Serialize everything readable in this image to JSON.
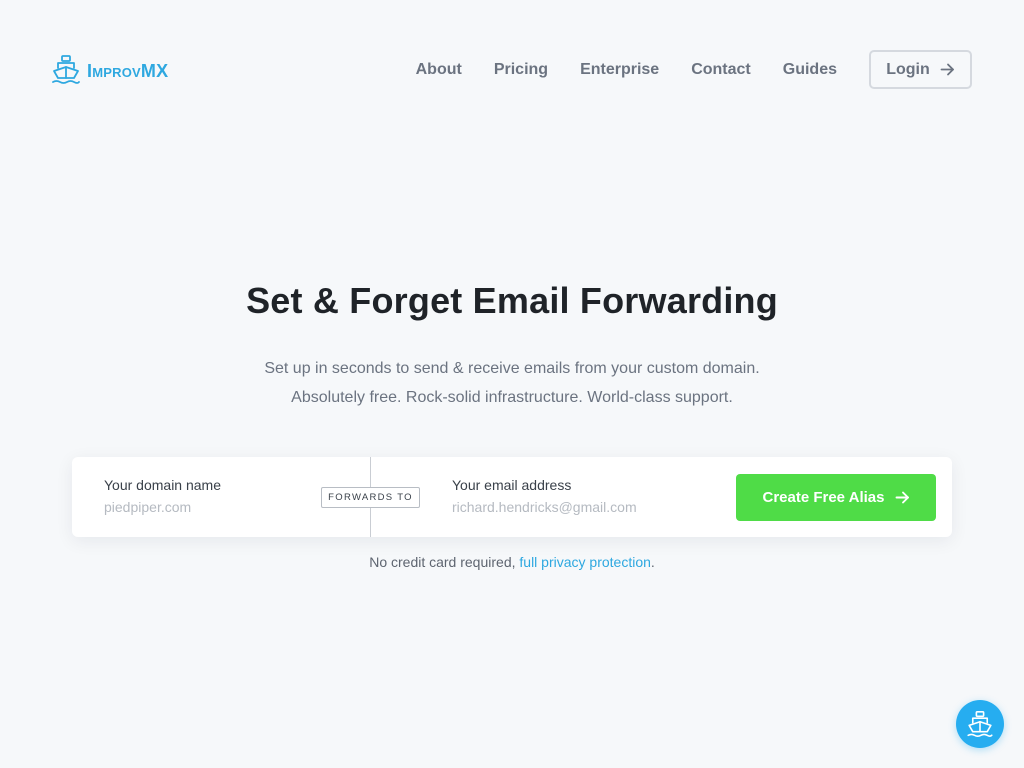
{
  "brand": {
    "name": "ImprovMX",
    "logo_icon": "ship-icon",
    "color": "#2ea8e0"
  },
  "nav": {
    "items": [
      "About",
      "Pricing",
      "Enterprise",
      "Contact",
      "Guides"
    ],
    "login_label": "Login",
    "login_icon": "arrow-right-icon"
  },
  "hero": {
    "title": "Set & Forget Email Forwarding",
    "subtitle_line1": "Set up in seconds to send & receive emails from your custom domain.",
    "subtitle_line2": "Absolutely free. Rock-solid infrastructure. World-class support."
  },
  "form": {
    "domain_label": "Your domain name",
    "domain_placeholder": "piedpiper.com",
    "forwards_badge": "FORWARDS TO",
    "email_label": "Your email address",
    "email_placeholder": "richard.hendricks@gmail.com",
    "submit_label": "Create Free Alias",
    "submit_color": "#4fdc47"
  },
  "note": {
    "text": "No credit card required, ",
    "link": "full privacy protection",
    "suffix": "."
  },
  "chat": {
    "icon": "ship-icon",
    "color": "#26adf0"
  }
}
